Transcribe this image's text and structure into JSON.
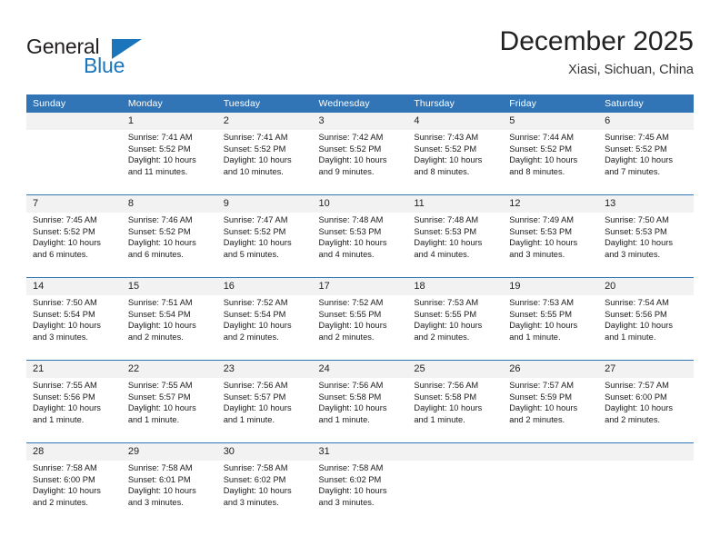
{
  "brand": {
    "name_part1": "General",
    "name_part2": "Blue",
    "accent_color": "#1b75bb",
    "triangle_icon": "brand-triangle-icon"
  },
  "header": {
    "title": "December 2025",
    "subtitle": "Xiasi, Sichuan, China"
  },
  "theme": {
    "header_bg": "#3275b7",
    "daynum_bg": "#f2f2f2",
    "separator": "#3275b7"
  },
  "weekday_headers": [
    "Sunday",
    "Monday",
    "Tuesday",
    "Wednesday",
    "Thursday",
    "Friday",
    "Saturday"
  ],
  "weeks": [
    {
      "days": [
        {
          "num": "",
          "sunrise": "",
          "sunset": "",
          "daylight1": "",
          "daylight2": ""
        },
        {
          "num": "1",
          "sunrise": "Sunrise: 7:41 AM",
          "sunset": "Sunset: 5:52 PM",
          "daylight1": "Daylight: 10 hours",
          "daylight2": "and 11 minutes."
        },
        {
          "num": "2",
          "sunrise": "Sunrise: 7:41 AM",
          "sunset": "Sunset: 5:52 PM",
          "daylight1": "Daylight: 10 hours",
          "daylight2": "and 10 minutes."
        },
        {
          "num": "3",
          "sunrise": "Sunrise: 7:42 AM",
          "sunset": "Sunset: 5:52 PM",
          "daylight1": "Daylight: 10 hours",
          "daylight2": "and 9 minutes."
        },
        {
          "num": "4",
          "sunrise": "Sunrise: 7:43 AM",
          "sunset": "Sunset: 5:52 PM",
          "daylight1": "Daylight: 10 hours",
          "daylight2": "and 8 minutes."
        },
        {
          "num": "5",
          "sunrise": "Sunrise: 7:44 AM",
          "sunset": "Sunset: 5:52 PM",
          "daylight1": "Daylight: 10 hours",
          "daylight2": "and 8 minutes."
        },
        {
          "num": "6",
          "sunrise": "Sunrise: 7:45 AM",
          "sunset": "Sunset: 5:52 PM",
          "daylight1": "Daylight: 10 hours",
          "daylight2": "and 7 minutes."
        }
      ]
    },
    {
      "days": [
        {
          "num": "7",
          "sunrise": "Sunrise: 7:45 AM",
          "sunset": "Sunset: 5:52 PM",
          "daylight1": "Daylight: 10 hours",
          "daylight2": "and 6 minutes."
        },
        {
          "num": "8",
          "sunrise": "Sunrise: 7:46 AM",
          "sunset": "Sunset: 5:52 PM",
          "daylight1": "Daylight: 10 hours",
          "daylight2": "and 6 minutes."
        },
        {
          "num": "9",
          "sunrise": "Sunrise: 7:47 AM",
          "sunset": "Sunset: 5:52 PM",
          "daylight1": "Daylight: 10 hours",
          "daylight2": "and 5 minutes."
        },
        {
          "num": "10",
          "sunrise": "Sunrise: 7:48 AM",
          "sunset": "Sunset: 5:53 PM",
          "daylight1": "Daylight: 10 hours",
          "daylight2": "and 4 minutes."
        },
        {
          "num": "11",
          "sunrise": "Sunrise: 7:48 AM",
          "sunset": "Sunset: 5:53 PM",
          "daylight1": "Daylight: 10 hours",
          "daylight2": "and 4 minutes."
        },
        {
          "num": "12",
          "sunrise": "Sunrise: 7:49 AM",
          "sunset": "Sunset: 5:53 PM",
          "daylight1": "Daylight: 10 hours",
          "daylight2": "and 3 minutes."
        },
        {
          "num": "13",
          "sunrise": "Sunrise: 7:50 AM",
          "sunset": "Sunset: 5:53 PM",
          "daylight1": "Daylight: 10 hours",
          "daylight2": "and 3 minutes."
        }
      ]
    },
    {
      "days": [
        {
          "num": "14",
          "sunrise": "Sunrise: 7:50 AM",
          "sunset": "Sunset: 5:54 PM",
          "daylight1": "Daylight: 10 hours",
          "daylight2": "and 3 minutes."
        },
        {
          "num": "15",
          "sunrise": "Sunrise: 7:51 AM",
          "sunset": "Sunset: 5:54 PM",
          "daylight1": "Daylight: 10 hours",
          "daylight2": "and 2 minutes."
        },
        {
          "num": "16",
          "sunrise": "Sunrise: 7:52 AM",
          "sunset": "Sunset: 5:54 PM",
          "daylight1": "Daylight: 10 hours",
          "daylight2": "and 2 minutes."
        },
        {
          "num": "17",
          "sunrise": "Sunrise: 7:52 AM",
          "sunset": "Sunset: 5:55 PM",
          "daylight1": "Daylight: 10 hours",
          "daylight2": "and 2 minutes."
        },
        {
          "num": "18",
          "sunrise": "Sunrise: 7:53 AM",
          "sunset": "Sunset: 5:55 PM",
          "daylight1": "Daylight: 10 hours",
          "daylight2": "and 2 minutes."
        },
        {
          "num": "19",
          "sunrise": "Sunrise: 7:53 AM",
          "sunset": "Sunset: 5:55 PM",
          "daylight1": "Daylight: 10 hours",
          "daylight2": "and 1 minute."
        },
        {
          "num": "20",
          "sunrise": "Sunrise: 7:54 AM",
          "sunset": "Sunset: 5:56 PM",
          "daylight1": "Daylight: 10 hours",
          "daylight2": "and 1 minute."
        }
      ]
    },
    {
      "days": [
        {
          "num": "21",
          "sunrise": "Sunrise: 7:55 AM",
          "sunset": "Sunset: 5:56 PM",
          "daylight1": "Daylight: 10 hours",
          "daylight2": "and 1 minute."
        },
        {
          "num": "22",
          "sunrise": "Sunrise: 7:55 AM",
          "sunset": "Sunset: 5:57 PM",
          "daylight1": "Daylight: 10 hours",
          "daylight2": "and 1 minute."
        },
        {
          "num": "23",
          "sunrise": "Sunrise: 7:56 AM",
          "sunset": "Sunset: 5:57 PM",
          "daylight1": "Daylight: 10 hours",
          "daylight2": "and 1 minute."
        },
        {
          "num": "24",
          "sunrise": "Sunrise: 7:56 AM",
          "sunset": "Sunset: 5:58 PM",
          "daylight1": "Daylight: 10 hours",
          "daylight2": "and 1 minute."
        },
        {
          "num": "25",
          "sunrise": "Sunrise: 7:56 AM",
          "sunset": "Sunset: 5:58 PM",
          "daylight1": "Daylight: 10 hours",
          "daylight2": "and 1 minute."
        },
        {
          "num": "26",
          "sunrise": "Sunrise: 7:57 AM",
          "sunset": "Sunset: 5:59 PM",
          "daylight1": "Daylight: 10 hours",
          "daylight2": "and 2 minutes."
        },
        {
          "num": "27",
          "sunrise": "Sunrise: 7:57 AM",
          "sunset": "Sunset: 6:00 PM",
          "daylight1": "Daylight: 10 hours",
          "daylight2": "and 2 minutes."
        }
      ]
    },
    {
      "days": [
        {
          "num": "28",
          "sunrise": "Sunrise: 7:58 AM",
          "sunset": "Sunset: 6:00 PM",
          "daylight1": "Daylight: 10 hours",
          "daylight2": "and 2 minutes."
        },
        {
          "num": "29",
          "sunrise": "Sunrise: 7:58 AM",
          "sunset": "Sunset: 6:01 PM",
          "daylight1": "Daylight: 10 hours",
          "daylight2": "and 3 minutes."
        },
        {
          "num": "30",
          "sunrise": "Sunrise: 7:58 AM",
          "sunset": "Sunset: 6:02 PM",
          "daylight1": "Daylight: 10 hours",
          "daylight2": "and 3 minutes."
        },
        {
          "num": "31",
          "sunrise": "Sunrise: 7:58 AM",
          "sunset": "Sunset: 6:02 PM",
          "daylight1": "Daylight: 10 hours",
          "daylight2": "and 3 minutes."
        },
        {
          "num": "",
          "sunrise": "",
          "sunset": "",
          "daylight1": "",
          "daylight2": ""
        },
        {
          "num": "",
          "sunrise": "",
          "sunset": "",
          "daylight1": "",
          "daylight2": ""
        },
        {
          "num": "",
          "sunrise": "",
          "sunset": "",
          "daylight1": "",
          "daylight2": ""
        }
      ]
    }
  ]
}
